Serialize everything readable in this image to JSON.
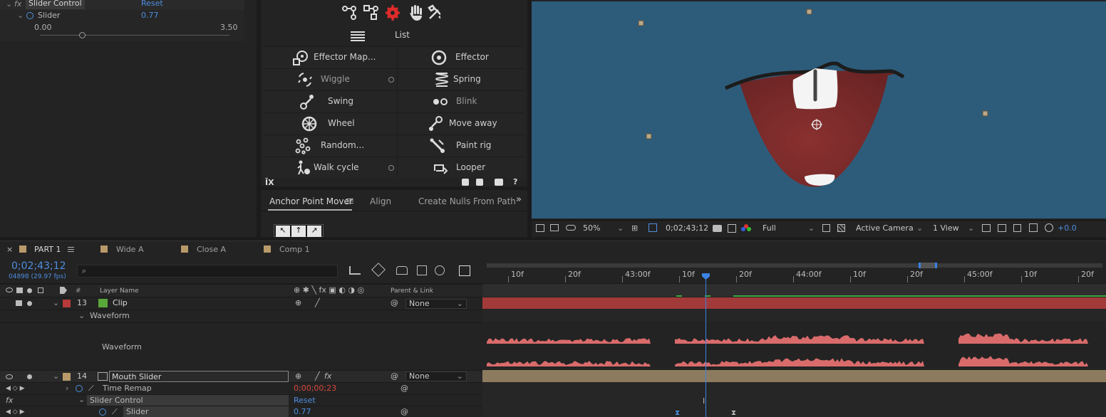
{
  "effect_controls": {
    "effect_name": "Slider Control",
    "reset_label": "Reset",
    "prop_label": "Slider",
    "prop_value": "0.77",
    "slider_min": "0.00",
    "slider_max": "3.50",
    "slider_fraction": 0.22
  },
  "duik": {
    "list_label": "List",
    "tools": [
      {
        "label": "Effector Map...",
        "icon": "effector-map-icon"
      },
      {
        "label": "Effector",
        "icon": "effector-icon"
      },
      {
        "label": "Wiggle",
        "icon": "wiggle-icon"
      },
      {
        "label": "Spring",
        "icon": "spring-icon"
      },
      {
        "label": "Swing",
        "icon": "swing-icon"
      },
      {
        "label": "Blink",
        "icon": "blink-icon"
      },
      {
        "label": "Wheel",
        "icon": "wheel-icon"
      },
      {
        "label": "Move away",
        "icon": "move-away-icon"
      },
      {
        "label": "Random...",
        "icon": "random-icon"
      },
      {
        "label": "Paint rig",
        "icon": "paint-rig-icon"
      },
      {
        "label": "Walk cycle",
        "icon": "walk-cycle-icon"
      },
      {
        "label": "Looper",
        "icon": "looper-icon"
      }
    ]
  },
  "anchor_panel": {
    "tabs": [
      "Anchor Point Mover",
      "Align",
      "Create Nulls From Path"
    ],
    "more": "»"
  },
  "viewer": {
    "zoom": "50%",
    "timecode": "0;02;43;12",
    "resolution": "Full",
    "camera": "Active Camera",
    "views": "1 View",
    "exposure": "+0.0",
    "bg_color": "#2d5c7b"
  },
  "timeline": {
    "tabs": [
      "PART 1",
      "Wide A",
      "Close A",
      "Comp 1"
    ],
    "timecode": "0;02;43;12",
    "frame_info": "04898 (29.97 fps)",
    "search_placeholder": "",
    "col_layer_name": "Layer Name",
    "col_parent": "Parent & Link",
    "col_hash": "#",
    "ruler_ticks": [
      "10f",
      "20f",
      "43:00f",
      "10f",
      "20f",
      "44:00f",
      "10f",
      "20f",
      "45:00f",
      "10f",
      "20f"
    ],
    "layers": [
      {
        "num": "13",
        "name": "Clip",
        "label_color": "#b83a3a",
        "parent": "None"
      },
      {
        "num": "14",
        "name": "Mouth Slider",
        "label_color": "#b89a6a",
        "parent": "None"
      }
    ],
    "waveform_group": "Waveform",
    "waveform_prop": "Waveform",
    "time_remap_label": "Time Remap",
    "time_remap_value": "0;00;00;23",
    "effect_name": "Slider Control",
    "effect_reset": "Reset",
    "slider_label": "Slider",
    "slider_value": "0.77",
    "fx_label": "fx"
  },
  "colors": {
    "accent_blue": "#4d8ee0",
    "clip_track": "#a33a3a",
    "mouth_track": "#8c7b5f",
    "waveform": "#d96b6b",
    "comp_bg": "#2d5c7b",
    "red_value": "#d8463c"
  }
}
